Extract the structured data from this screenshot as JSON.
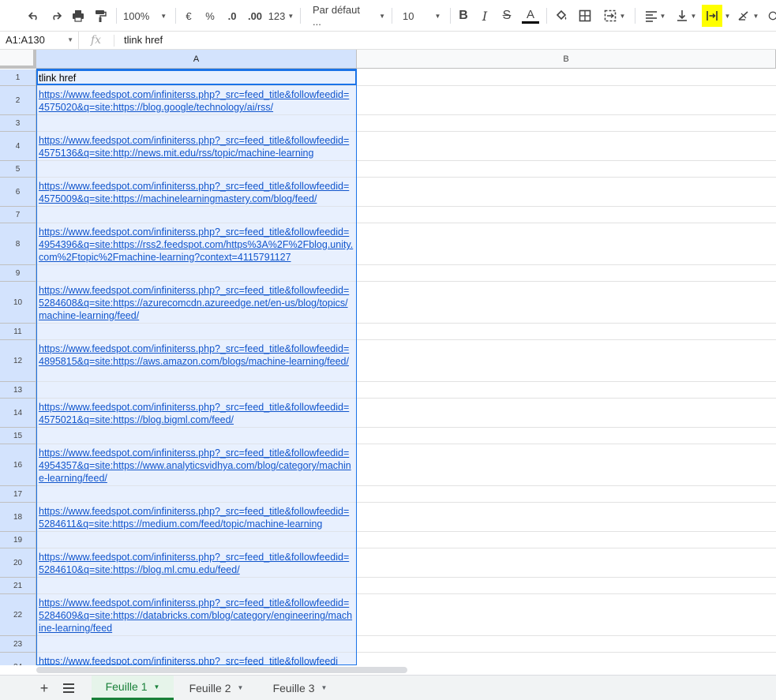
{
  "toolbar": {
    "zoom": "100%",
    "currency": "€",
    "percent": "%",
    "dec_decrease": ".0",
    "dec_increase": ".00",
    "format_more": "123",
    "font": "Par défaut ...",
    "font_size": "10",
    "highlight_color": "#ffff00",
    "text_color_bar": "#000000"
  },
  "formula_bar": {
    "name_box": "A1:A130",
    "fx": "fx",
    "value": "tlink href"
  },
  "columns": [
    "A",
    "B"
  ],
  "rows": [
    {
      "num": "1",
      "a": "tlink href",
      "link": false
    },
    {
      "num": "2",
      "a": "https://www.feedspot.com/infiniterss.php?_src=feed_title&followfeedid=4575020&q=site:https://blog.google/technology/ai/rss/",
      "link": true
    },
    {
      "num": "3",
      "a": "",
      "link": false
    },
    {
      "num": "4",
      "a": "https://www.feedspot.com/infiniterss.php?_src=feed_title&followfeedid=4575136&q=site:http://news.mit.edu/rss/topic/machine-learning",
      "link": true
    },
    {
      "num": "5",
      "a": "",
      "link": false
    },
    {
      "num": "6",
      "a": "https://www.feedspot.com/infiniterss.php?_src=feed_title&followfeedid=4575009&q=site:https://machinelearningmastery.com/blog/feed/",
      "link": true
    },
    {
      "num": "7",
      "a": "",
      "link": false
    },
    {
      "num": "8",
      "a": "https://www.feedspot.com/infiniterss.php?_src=feed_title&followfeedid=4954396&q=site:https://rss2.feedspot.com/https%3A%2F%2Fblog.unity.com%2Ftopic%2Fmachine-learning?context=4115791127",
      "link": true
    },
    {
      "num": "9",
      "a": "",
      "link": false
    },
    {
      "num": "10",
      "a": "https://www.feedspot.com/infiniterss.php?_src=feed_title&followfeedid=5284608&q=site:https://azurecomcdn.azureedge.net/en-us/blog/topics/machine-learning/feed/",
      "link": true
    },
    {
      "num": "11",
      "a": "",
      "link": false
    },
    {
      "num": "12",
      "a": "https://www.feedspot.com/infiniterss.php?_src=feed_title&followfeedid=4895815&q=site:https://aws.amazon.com/blogs/machine-learning/feed/",
      "link": true
    },
    {
      "num": "13",
      "a": "",
      "link": false
    },
    {
      "num": "14",
      "a": "https://www.feedspot.com/infiniterss.php?_src=feed_title&followfeedid=4575021&q=site:https://blog.bigml.com/feed/",
      "link": true
    },
    {
      "num": "15",
      "a": "",
      "link": false
    },
    {
      "num": "16",
      "a": "https://www.feedspot.com/infiniterss.php?_src=feed_title&followfeedid=4954357&q=site:https://www.analyticsvidhya.com/blog/category/machine-learning/feed/",
      "link": true
    },
    {
      "num": "17",
      "a": "",
      "link": false
    },
    {
      "num": "18",
      "a": "https://www.feedspot.com/infiniterss.php?_src=feed_title&followfeedid=5284611&q=site:https://medium.com/feed/topic/machine-learning",
      "link": true
    },
    {
      "num": "19",
      "a": "",
      "link": false
    },
    {
      "num": "20",
      "a": "https://www.feedspot.com/infiniterss.php?_src=feed_title&followfeedid=5284610&q=site:https://blog.ml.cmu.edu/feed/",
      "link": true
    },
    {
      "num": "21",
      "a": "",
      "link": false
    },
    {
      "num": "22",
      "a": "https://www.feedspot.com/infiniterss.php?_src=feed_title&followfeedid=5284609&q=site:https://databricks.com/blog/category/engineering/machine-learning/feed",
      "link": true
    },
    {
      "num": "23",
      "a": "",
      "link": false
    },
    {
      "num": "24",
      "a": "https://www.feedspot.com/infiniterss.php?_src=feed_title&followfeedi",
      "link": true
    }
  ],
  "sheets": [
    {
      "label": "Feuille 1",
      "active": true
    },
    {
      "label": "Feuille 2",
      "active": false
    },
    {
      "label": "Feuille 3",
      "active": false
    }
  ],
  "icons": {
    "add_sheet": "plus-icon",
    "all_sheets": "list-icon"
  }
}
